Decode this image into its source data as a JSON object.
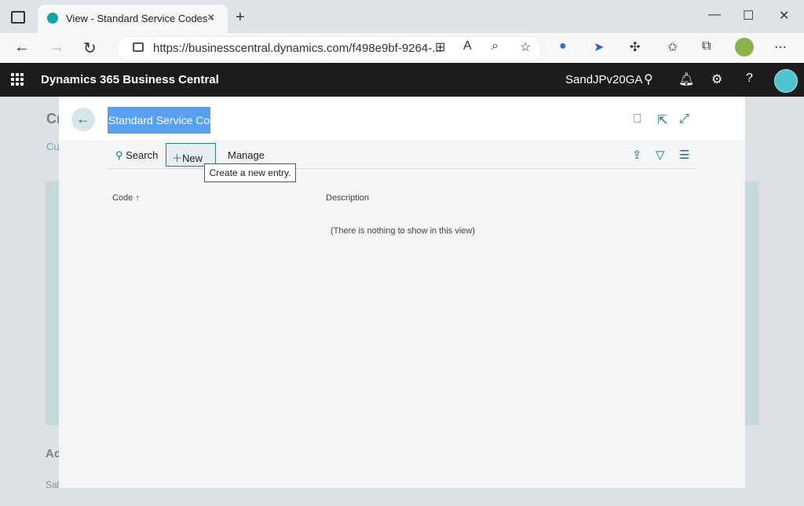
{
  "browser": {
    "tab_title": "View - Standard Service Codes -",
    "tab_close": "×",
    "new_tab": "+",
    "url": "https://businesscentral.dynamics.com/f498e9bf-9264-...",
    "window_controls": [
      "—",
      "☐",
      "✕"
    ]
  },
  "bc_header": {
    "app_title": "Dynamics 365 Business Central",
    "company": "SandJPv20GA",
    "icons": [
      "search-icon",
      "bell-icon",
      "gear-icon",
      "help-icon"
    ]
  },
  "background_page": {
    "title_partial": "Cr",
    "link_partial": "Cu",
    "section_partial": "Ac",
    "item_partial": "Sal"
  },
  "dialog": {
    "title": "Standard Service Codes",
    "actions": {
      "search": "Search",
      "new": "New",
      "manage": "Manage"
    },
    "tooltip": "Create a new entry.",
    "columns": {
      "code": "Code",
      "description": "Description"
    },
    "empty_message": "(There is nothing to show in this view)"
  },
  "colors": {
    "bc_header_bg": "#1c1c1c",
    "accent": "#1f6f7b",
    "title_selection": "#5aa0f0"
  }
}
